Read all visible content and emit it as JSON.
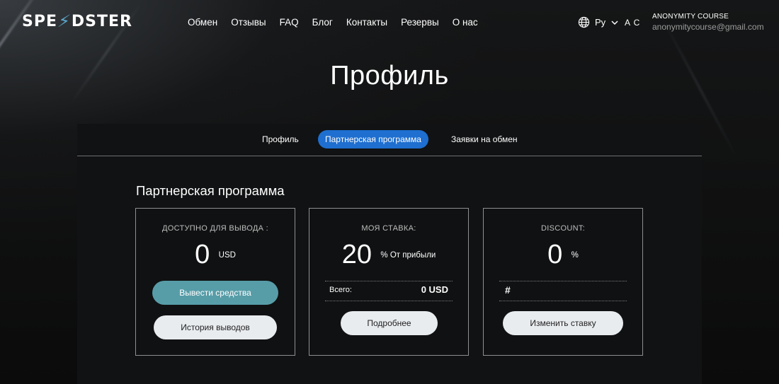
{
  "logo": {
    "part1": "SPE",
    "part2": "DSTER"
  },
  "nav": [
    "Обмен",
    "Отзывы",
    "FAQ",
    "Блог",
    "Контакты",
    "Резервы",
    "О нас"
  ],
  "lang": {
    "label": "Ру"
  },
  "user": {
    "initials": "A C",
    "name": "ANONYMITY COURSE",
    "email": "anonymitycourse@gmail.com"
  },
  "page_title": "Профиль",
  "tabs": [
    {
      "label": "Профиль",
      "active": false
    },
    {
      "label": "Партнерская программа",
      "active": true
    },
    {
      "label": "Заявки на обмен",
      "active": false
    }
  ],
  "section_title": "Партнерская программа",
  "cards": {
    "available": {
      "label": "ДОСТУПНО ДЛЯ ВЫВОДА :",
      "value": "0",
      "unit": "USD",
      "withdraw_button": "Вывести средства",
      "history_button": "История выводов"
    },
    "rate": {
      "label": "МОЯ СТАВКА:",
      "value": "20",
      "unit": "% От прибыли",
      "total_label": "Всего:",
      "total_value": "0 USD",
      "details_button": "Подробнее"
    },
    "discount": {
      "label": "DISCOUNT:",
      "value": "0",
      "unit": "%",
      "hash": "#",
      "change_button": "Изменить ставку"
    }
  },
  "colors": {
    "accent_tab": "#1e6fd0",
    "teal_button": "#579da8",
    "logo_bolt": "#59a6c9"
  }
}
